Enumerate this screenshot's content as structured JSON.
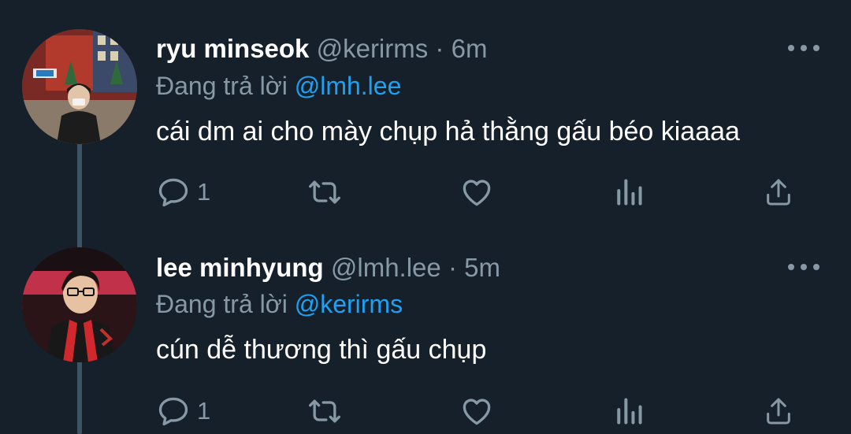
{
  "thread": [
    {
      "name": "ryu minseok",
      "handle": "@kerirms",
      "separator": "·",
      "time": "6m",
      "reply_prefix": "Đang trả lời",
      "reply_to": "@lmh.lee",
      "text": "cái dm ai cho mày chụp hả thằng gấu béo kiaaaa",
      "reply_count": "1",
      "avatar_icon": "user-photo-city-night"
    },
    {
      "name": "lee minhyung",
      "handle": "@lmh.lee",
      "separator": "·",
      "time": "5m",
      "reply_prefix": "Đang trả lời",
      "reply_to": "@kerirms",
      "text": "cún dễ thương thì gấu chụp",
      "reply_count": "1",
      "avatar_icon": "user-photo-red-stage"
    }
  ],
  "icons": {
    "reply": "comment-icon",
    "retweet": "retweet-icon",
    "like": "heart-icon",
    "analytics": "analytics-icon",
    "share": "share-icon",
    "more": "more-dots-icon"
  },
  "colors": {
    "background": "#15202b",
    "muted": "#8899a6",
    "link": "#1da1f2",
    "thread_line": "#3d5466"
  }
}
